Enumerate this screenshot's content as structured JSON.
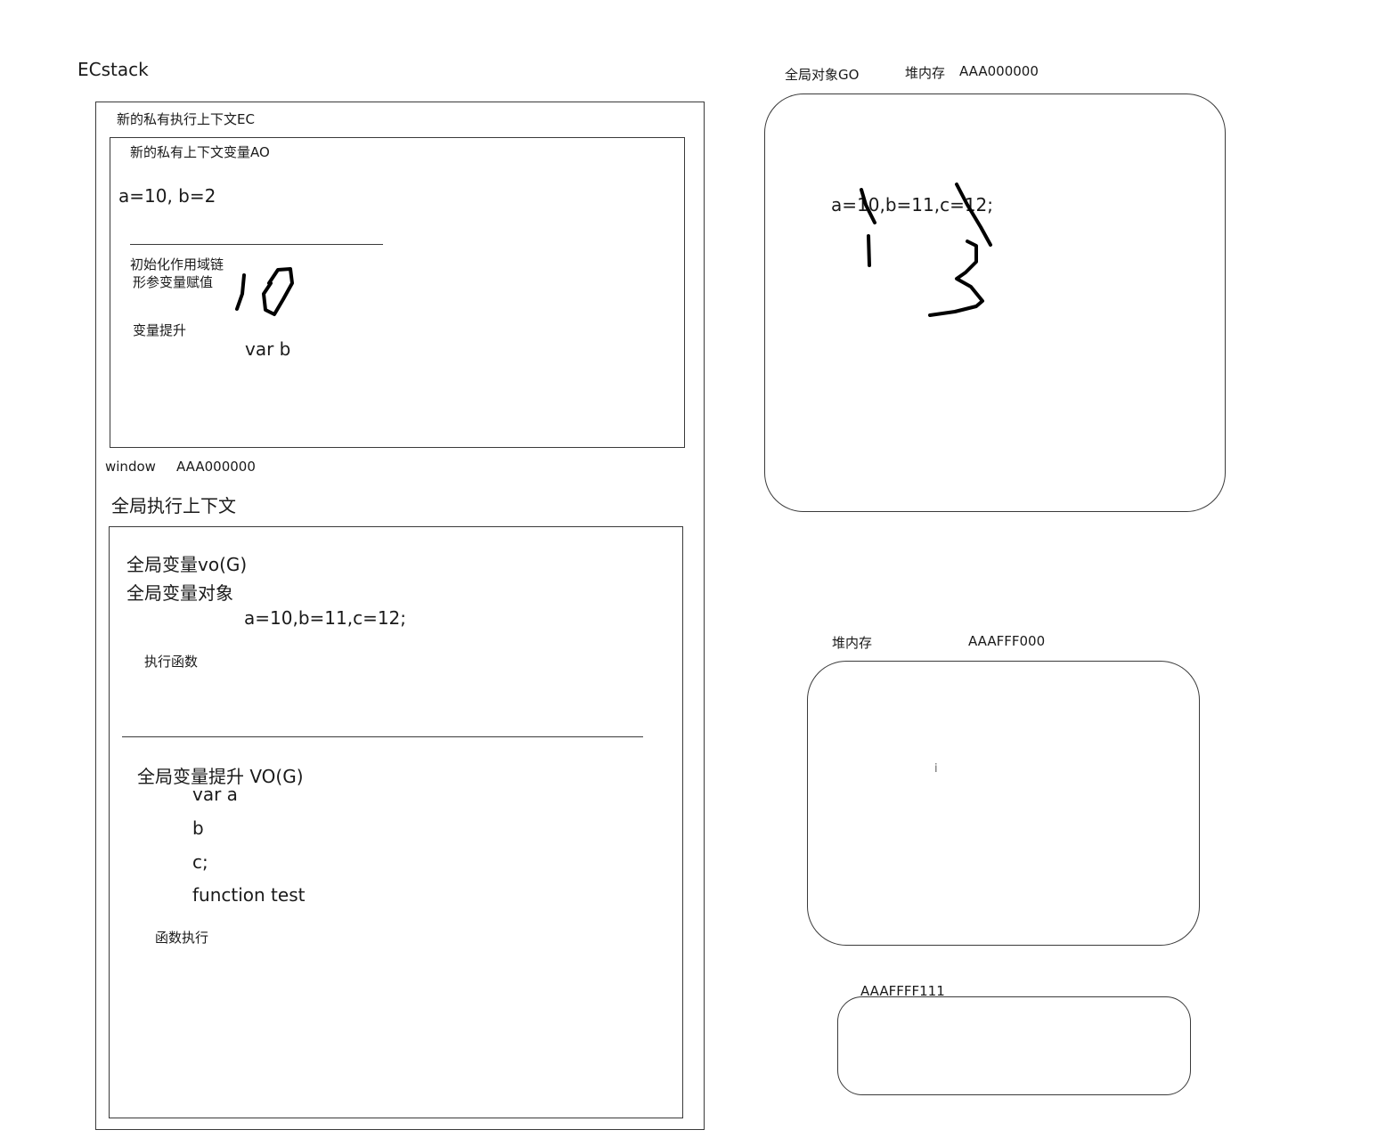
{
  "ecstack": {
    "title": "ECstack",
    "private_ec": {
      "label": "新的私有执行上下文EC",
      "ao": {
        "label": "新的私有上下文变量AO",
        "values": "a=10, b=2",
        "steps": [
          "初始化作用域链",
          "形参变量赋值"
        ],
        "hoist_label": "变量提升",
        "hoist_value": "var b"
      }
    },
    "window_label": "window",
    "window_address": "AAA000000",
    "global_ec": {
      "label": "全局执行上下文",
      "vo": {
        "label": "全局变量vo(G)",
        "sublabel": "全局变量对象",
        "values": "a=10,b=11,c=12;",
        "exec_label": "执行函数",
        "hoist_label": "全局变量提升 VO(G)",
        "hoist_items": [
          "var a",
          "b",
          "c;",
          "function test"
        ],
        "func_exec_label": "函数执行"
      }
    }
  },
  "heap": {
    "global_object_label": "全局对象GO",
    "go_heap_label": "堆内存",
    "go_address": "AAA000000",
    "go_values": "a=10,b=11,c=12;",
    "heap2_label": "堆内存",
    "heap2_address": "AAAFFF000",
    "heap2_mark": "i",
    "heap3_address": "AAAFFFF111"
  }
}
